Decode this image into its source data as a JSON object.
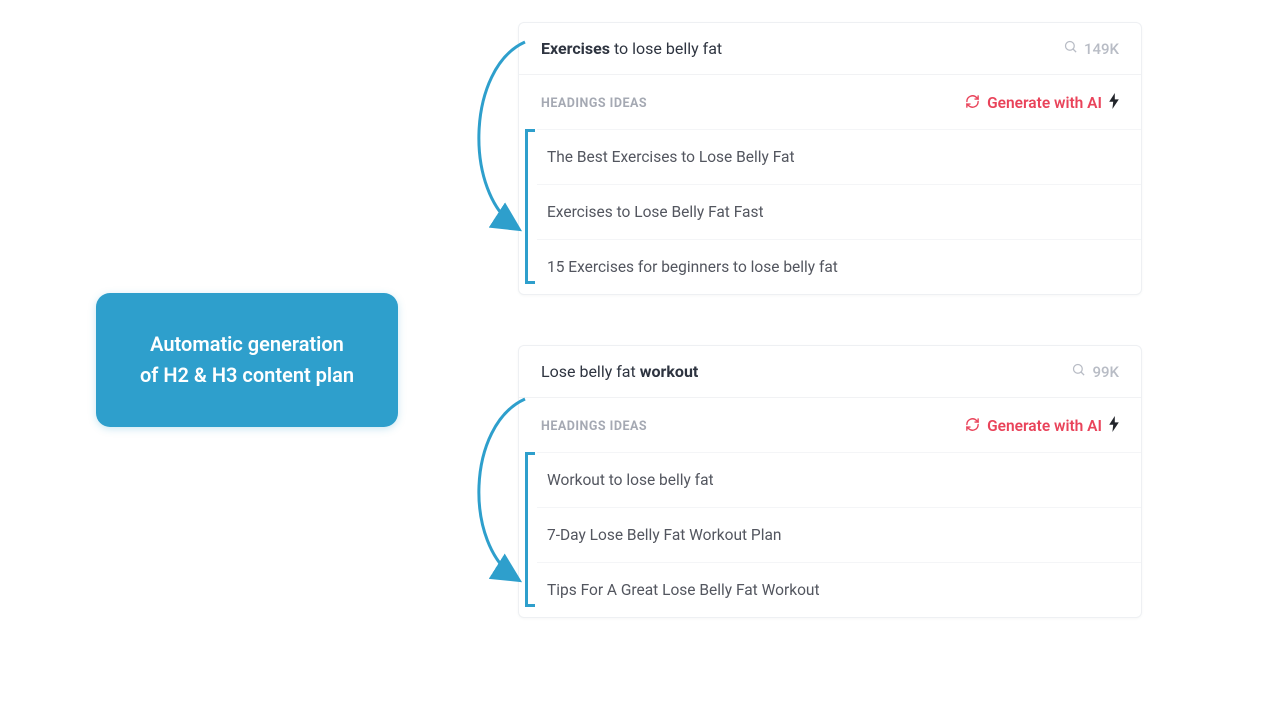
{
  "callout": {
    "line1": "Automatic generation",
    "line2": "of H2 & H3 content plan"
  },
  "panels": [
    {
      "keyword_strong": "Exercises",
      "keyword_rest": " to lose belly fat",
      "volume": "149K",
      "sub_label": "HEADINGS IDEAS",
      "generate_label": "Generate with AI",
      "headings": [
        "The Best Exercises to Lose Belly Fat",
        "Exercises to Lose Belly Fat Fast",
        "15 Exercises for beginners to lose belly fat"
      ]
    },
    {
      "keyword_pre": "Lose belly fat ",
      "keyword_strong": "workout",
      "volume": "99K",
      "sub_label": "HEADINGS IDEAS",
      "generate_label": "Generate with AI",
      "headings": [
        "Workout to lose belly fat",
        "7-Day Lose Belly Fat Workout Plan",
        "Tips For A Great Lose Belly Fat Workout"
      ]
    }
  ]
}
